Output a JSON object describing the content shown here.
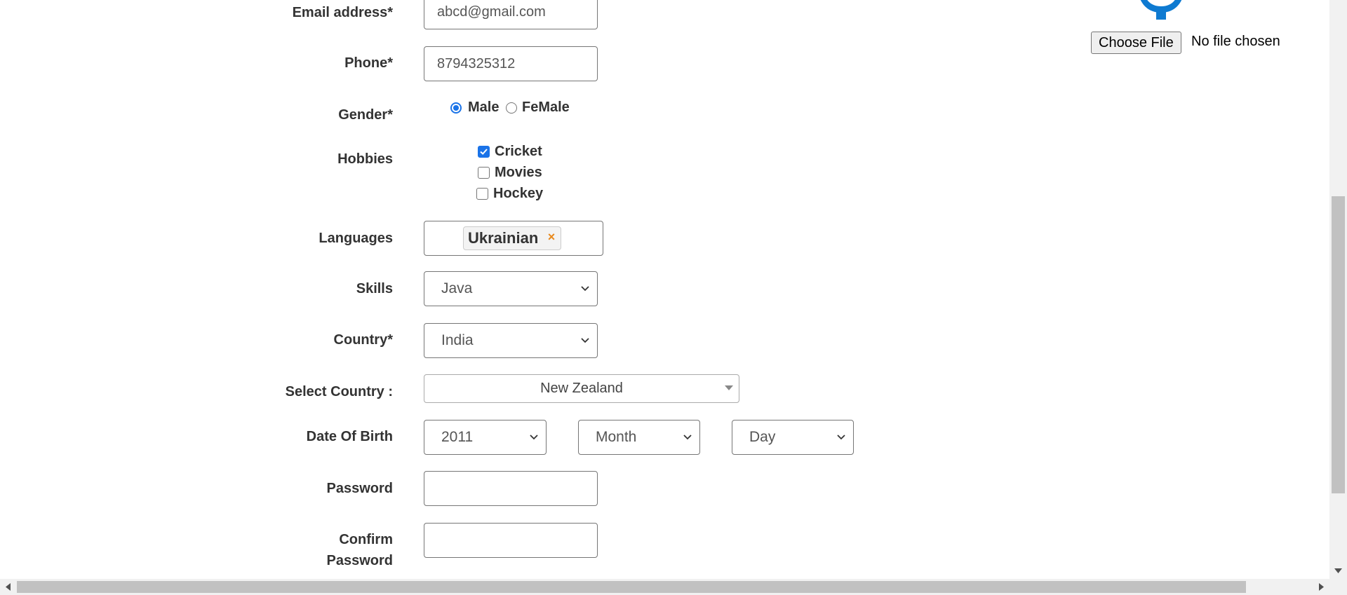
{
  "form": {
    "email": {
      "label": "Email address*",
      "value": "abcd@gmail.com"
    },
    "phone": {
      "label": "Phone*",
      "value": "8794325312"
    },
    "gender": {
      "label": "Gender*",
      "options": [
        "Male",
        "FeMale"
      ],
      "selected": "Male"
    },
    "hobbies": {
      "label": "Hobbies",
      "options": [
        {
          "label": "Cricket",
          "checked": true
        },
        {
          "label": "Movies",
          "checked": false
        },
        {
          "label": "Hockey",
          "checked": false
        }
      ]
    },
    "languages": {
      "label": "Languages",
      "selected": [
        "Ukrainian"
      ],
      "remove_glyph": "×"
    },
    "skills": {
      "label": "Skills",
      "value": "Java"
    },
    "country": {
      "label": "Country*",
      "value": "India"
    },
    "select_country": {
      "label": "Select Country :",
      "value": "New Zealand"
    },
    "dob": {
      "label": "Date Of Birth",
      "year": "2011",
      "month": "Month",
      "day": "Day"
    },
    "password": {
      "label": "Password",
      "value": ""
    },
    "confirm_password": {
      "label_line1": "Confirm",
      "label_line2": "Password",
      "value": ""
    }
  },
  "upload": {
    "button_label": "Choose File",
    "status": "No file chosen",
    "icon": "gear-icon",
    "icon_color": "#0e7ad1"
  },
  "colors": {
    "accent": "#1a73e8",
    "chip_remove": "#e8891d"
  }
}
